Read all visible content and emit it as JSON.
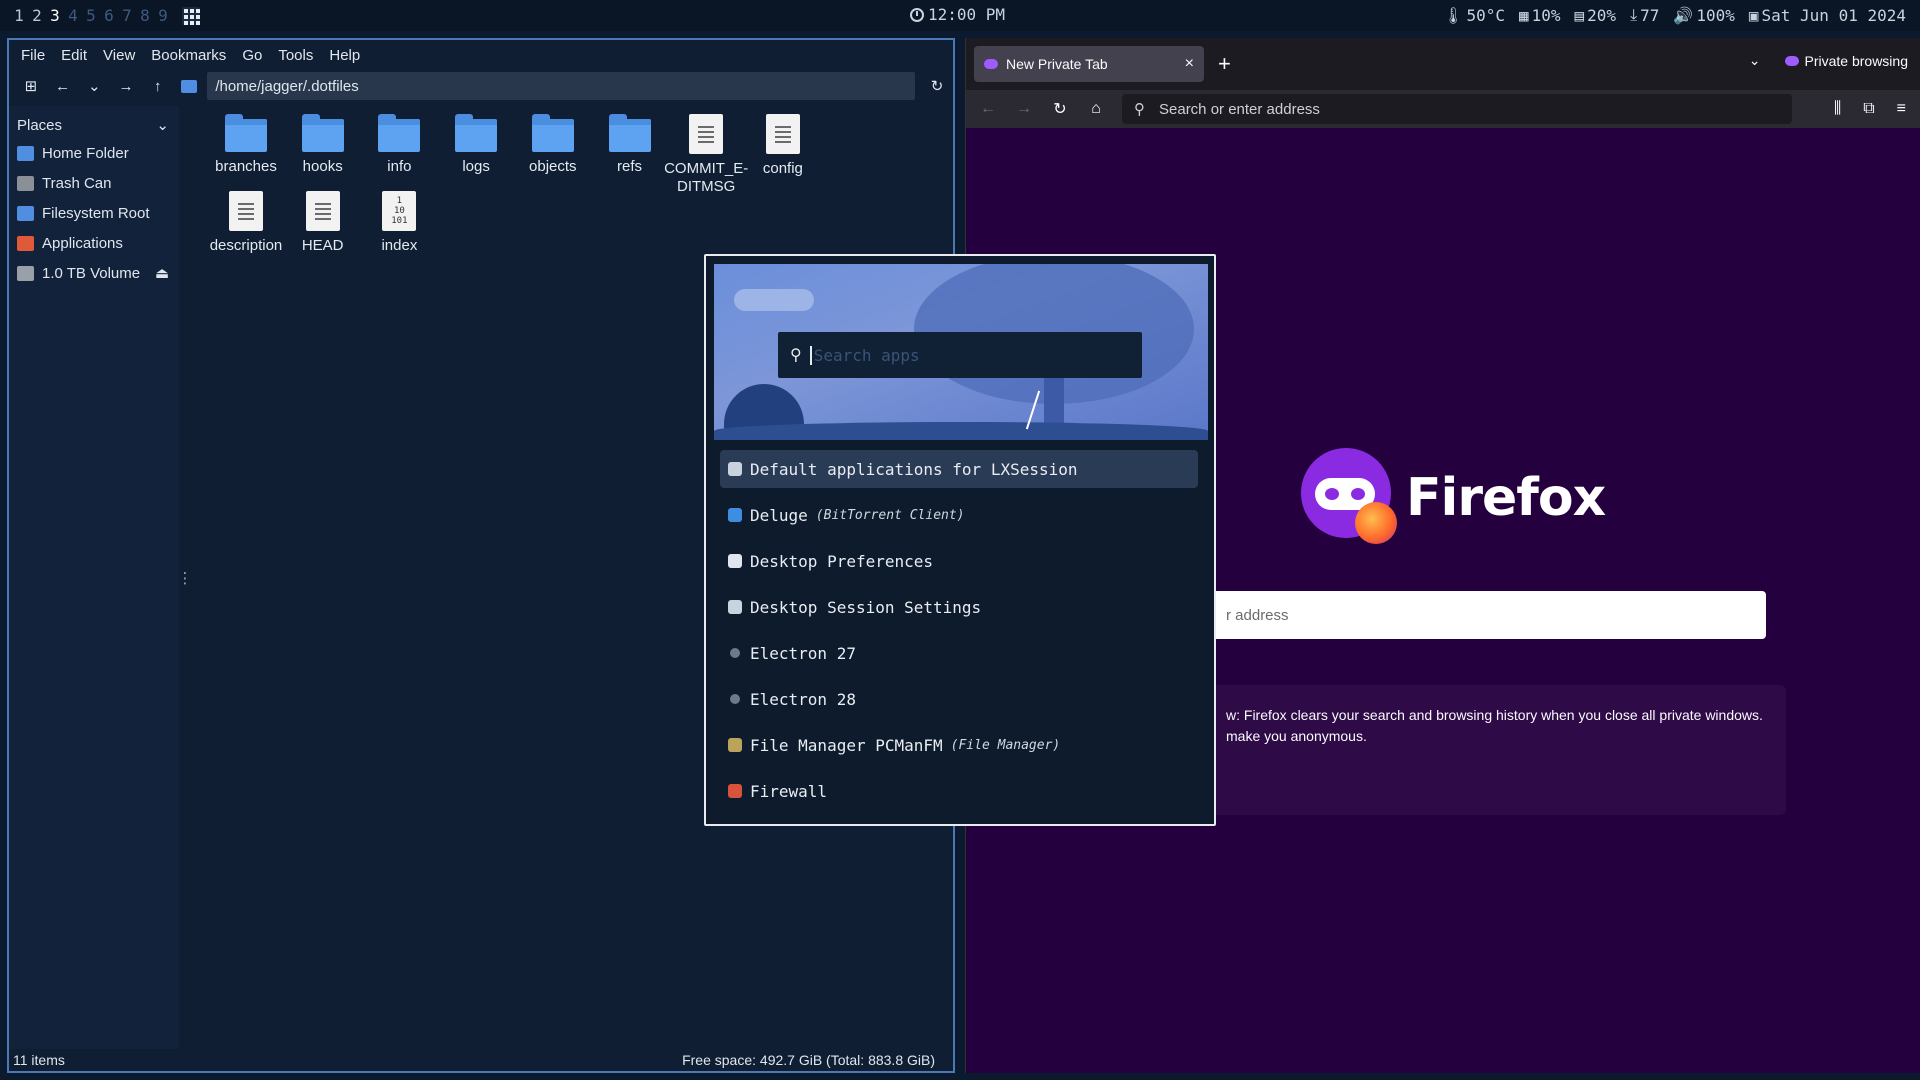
{
  "topbar": {
    "workspaces": [
      {
        "label": "1",
        "state": "occupied"
      },
      {
        "label": "2",
        "state": "occupied"
      },
      {
        "label": "3",
        "state": "active"
      },
      {
        "label": "4",
        "state": "empty"
      },
      {
        "label": "5",
        "state": "empty"
      },
      {
        "label": "6",
        "state": "empty"
      },
      {
        "label": "7",
        "state": "empty"
      },
      {
        "label": "8",
        "state": "empty"
      },
      {
        "label": "9",
        "state": "empty"
      }
    ],
    "clock": "12:00 PM",
    "temperature": "50°C",
    "cpu": "10%",
    "memory": "20%",
    "updates": "77",
    "volume": "100%",
    "date": "Sat Jun 01 2024"
  },
  "file_manager": {
    "menu": [
      "File",
      "Edit",
      "View",
      "Bookmarks",
      "Go",
      "Tools",
      "Help"
    ],
    "path": "/home/jagger/.dotfiles",
    "places_title": "Places",
    "places": [
      {
        "label": "Home Folder",
        "icon": "home-folder-icon",
        "color": "#4f8ee0"
      },
      {
        "label": "Trash Can",
        "icon": "trash-icon",
        "color": "#8a8f98"
      },
      {
        "label": "Filesystem Root",
        "icon": "folder-icon",
        "color": "#4f8ee0"
      },
      {
        "label": "Applications",
        "icon": "applications-icon",
        "color": "#e05a3a"
      },
      {
        "label": "1.0 TB Volume",
        "icon": "drive-icon",
        "color": "#9aa0a8"
      }
    ],
    "items": [
      {
        "name": "branches",
        "kind": "folder"
      },
      {
        "name": "hooks",
        "kind": "folder"
      },
      {
        "name": "info",
        "kind": "folder"
      },
      {
        "name": "logs",
        "kind": "folder"
      },
      {
        "name": "objects",
        "kind": "folder"
      },
      {
        "name": "refs",
        "kind": "folder"
      },
      {
        "name": "COMMIT_E-\nDITMSG",
        "kind": "text"
      },
      {
        "name": "config",
        "kind": "text"
      },
      {
        "name": "description",
        "kind": "text"
      },
      {
        "name": "HEAD",
        "kind": "text"
      },
      {
        "name": "index",
        "kind": "binary"
      }
    ],
    "status_left": "11 items",
    "status_right": "Free space: 492.7 GiB (Total: 883.8 GiB)"
  },
  "firefox": {
    "tab_title": "New Private Tab",
    "private_label": "Private browsing",
    "url_placeholder": "Search or enter address",
    "wordmark": "Firefox",
    "search_visible": "r address",
    "note_line1": "w: Firefox clears your search and browsing history when you close all private windows.",
    "note_line2": "make you anonymous."
  },
  "launcher": {
    "placeholder": "Search apps",
    "apps": [
      {
        "name": "Default applications for LXSession",
        "sub": "",
        "icon_color": "#c9d3e0",
        "selected": true
      },
      {
        "name": "Deluge",
        "sub": "(BitTorrent Client)",
        "icon_color": "#3d8de0",
        "selected": false
      },
      {
        "name": "Desktop Preferences",
        "sub": "",
        "icon_color": "#dfe6ee",
        "selected": false
      },
      {
        "name": "Desktop Session Settings",
        "sub": "",
        "icon_color": "#c9d3e0",
        "selected": false
      },
      {
        "name": "Electron 27",
        "sub": "",
        "icon_color": "#6b7a8c",
        "selected": false
      },
      {
        "name": "Electron 28",
        "sub": "",
        "icon_color": "#6b7a8c",
        "selected": false
      },
      {
        "name": "File Manager PCManFM",
        "sub": "(File Manager)",
        "icon_color": "#b9a45a",
        "selected": false
      },
      {
        "name": "Firewall",
        "sub": "",
        "icon_color": "#d9533a",
        "selected": false
      }
    ]
  }
}
